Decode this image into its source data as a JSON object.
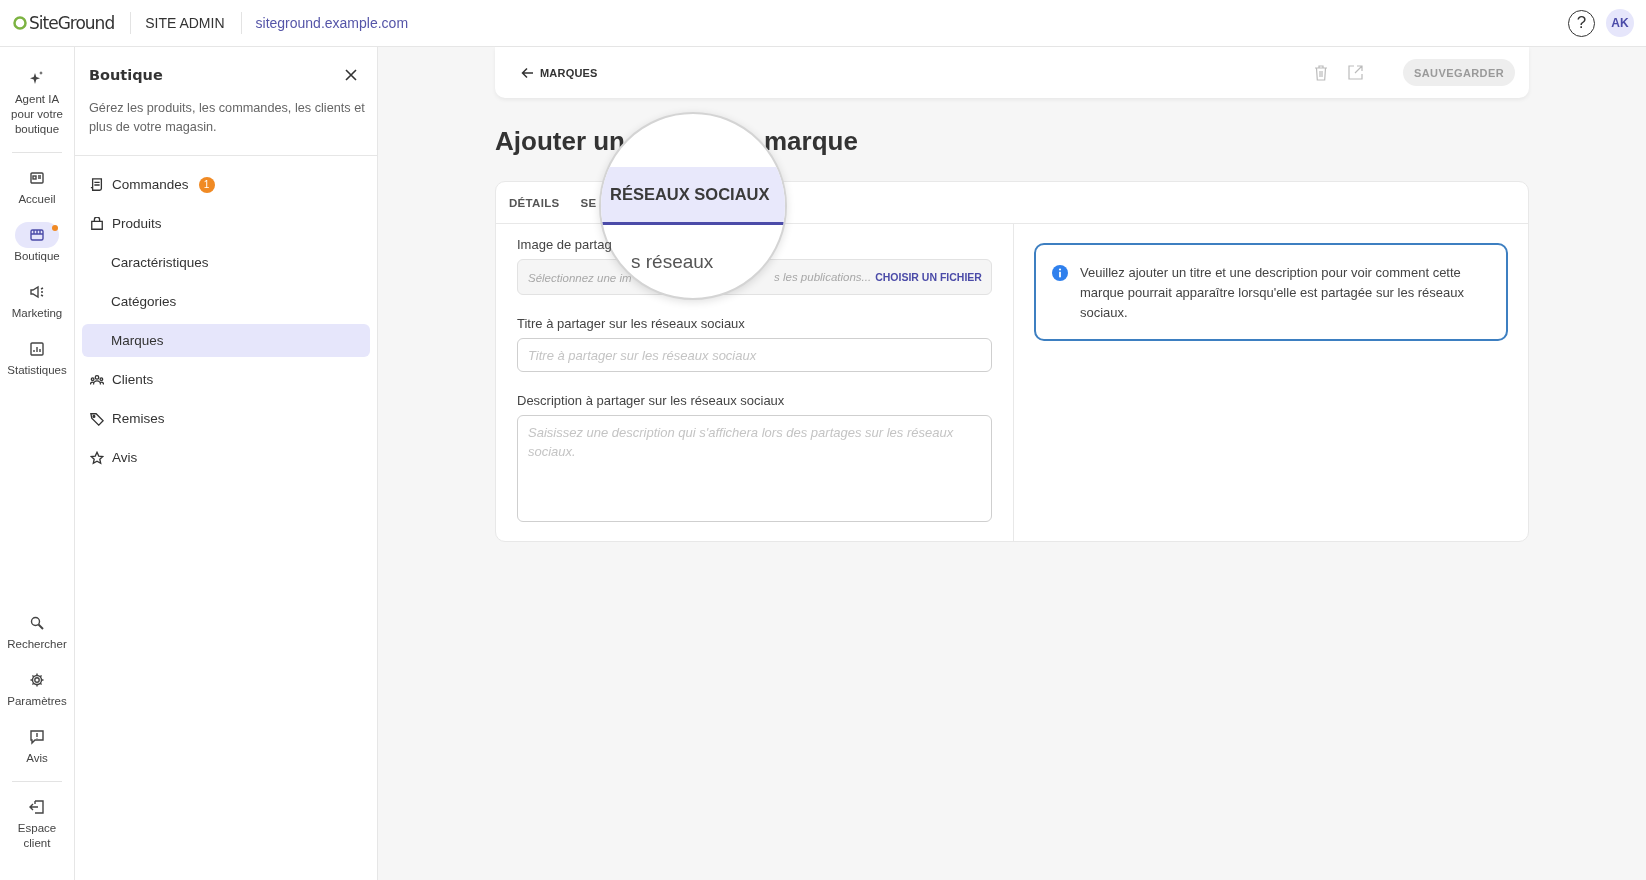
{
  "topbar": {
    "logo": "SiteGround",
    "section": "SITE ADMIN",
    "domain": "siteground.example.com",
    "help": "?",
    "avatar": "AK"
  },
  "rail": {
    "items": [
      {
        "label": "Agent IA pour votre boutique",
        "selected": false,
        "notification": false
      },
      {
        "label": "Accueil",
        "selected": false,
        "notification": false
      },
      {
        "label": "Boutique",
        "selected": true,
        "notification": true
      },
      {
        "label": "Marketing",
        "selected": false,
        "notification": false
      },
      {
        "label": "Statistiques",
        "selected": false,
        "notification": false
      },
      {
        "label": "Rechercher",
        "selected": false,
        "notification": false
      },
      {
        "label": "Paramètres",
        "selected": false,
        "notification": false
      },
      {
        "label": "Avis",
        "selected": false,
        "notification": false
      },
      {
        "label": "Espace client",
        "selected": false,
        "notification": false
      }
    ]
  },
  "panel": {
    "title": "Boutique",
    "description": "Gérez les produits, les commandes, les clients et plus de votre magasin.",
    "items": [
      {
        "label": "Commandes",
        "badge": "1",
        "selected": false
      },
      {
        "label": "Produits",
        "selected": false,
        "children": [
          {
            "label": "Caractéristiques",
            "selected": false
          },
          {
            "label": "Catégories",
            "selected": false
          },
          {
            "label": "Marques",
            "selected": true
          }
        ]
      },
      {
        "label": "Clients",
        "selected": false
      },
      {
        "label": "Remises",
        "selected": false
      },
      {
        "label": "Avis",
        "selected": false
      }
    ]
  },
  "header": {
    "back": "MARQUES",
    "save": {
      "label": "SAUVEGARDER",
      "disabled": true
    }
  },
  "title": {
    "visible_start": "Ajouter un",
    "visible_end": "marque"
  },
  "tabs": [
    {
      "label": "DÉTAILS",
      "selected": false
    },
    {
      "label": "SE",
      "selected": false
    }
  ],
  "magnifier": {
    "tab": {
      "label": "RÉSEAUX SOCIAUX",
      "selected": true
    },
    "text": "s réseaux"
  },
  "form": {
    "image": {
      "label": "Image de partag",
      "placeholder_start": "Sélectionnez une im",
      "placeholder_end": "s les publications...",
      "button": "CHOISIR UN FICHIER"
    },
    "title_field": {
      "label": "Titre à partager sur les réseaux sociaux",
      "placeholder": "Titre à partager sur les réseaux sociaux"
    },
    "description": {
      "label": "Description à partager sur les réseaux sociaux",
      "placeholder": "Saisissez une description qui s'affichera lors des partages sur les réseaux sociaux."
    }
  },
  "info": "Veuillez ajouter un titre et une description pour voir comment cette marque pourrait apparaître lorsqu'elle est partagée sur les réseaux sociaux."
}
